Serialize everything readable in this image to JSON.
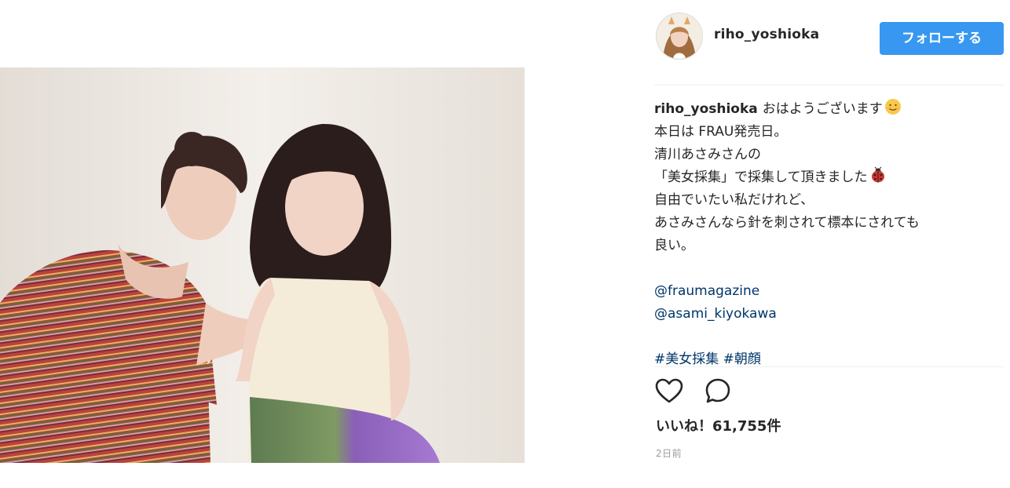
{
  "post": {
    "username": "riho_yoshioka",
    "follow_label": "フォローする",
    "caption": {
      "username": "riho_yoshioka",
      "lines": [
        "おはようございます",
        "本日は FRAU発売日。",
        "清川あさみさんの",
        "「美女採集」で採集して頂きました",
        "自由でいたい私だけれど、",
        "あさみさんなら針を刺されて標本にされても",
        "良い。"
      ],
      "mentions": [
        "@fraumagazine",
        "@asami_kiyokawa"
      ],
      "hashtags": [
        "#美女採集",
        "#朝顔"
      ]
    },
    "likes_text": "いいね！61,755件",
    "timestamp": "2日前"
  },
  "icons": {
    "like": "heart-icon",
    "comment": "comment-icon",
    "smile_emoji": "smiling-face-emoji",
    "ladybug_emoji": "ladybug-emoji"
  },
  "colors": {
    "follow_button": "#3897f0",
    "link": "#003569",
    "text": "#262626",
    "muted": "#999999"
  }
}
